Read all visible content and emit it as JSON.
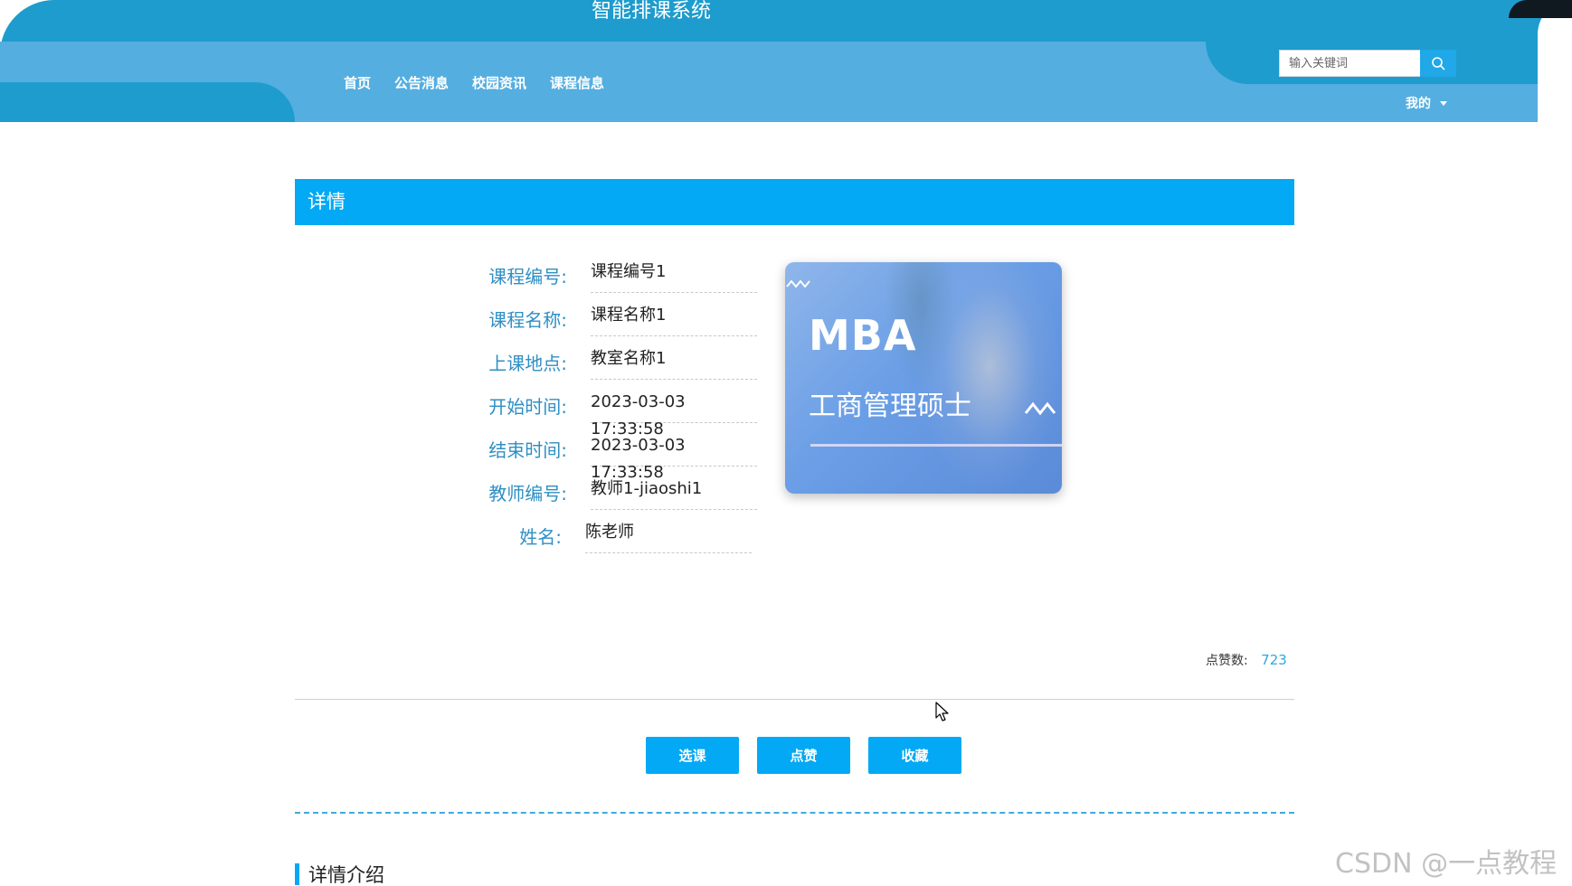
{
  "header": {
    "site_title": "智能排课系统",
    "nav": [
      "首页",
      "公告消息",
      "校园资讯",
      "课程信息"
    ],
    "search_placeholder": "输入关键词",
    "search_icon": "search-icon",
    "user_menu_label": "我的"
  },
  "detail": {
    "section_title": "详情",
    "fields": [
      {
        "label": "课程编号:",
        "value": "课程编号1"
      },
      {
        "label": "课程名称:",
        "value": "课程名称1"
      },
      {
        "label": "上课地点:",
        "value": "教室名称1"
      },
      {
        "label": "开始时间:",
        "value": "2023-03-03 17:33:58"
      },
      {
        "label": "结束时间:",
        "value": "2023-03-03 17:33:58"
      },
      {
        "label": "教师编号:",
        "value": "教师1-jiaoshi1"
      },
      {
        "label": "姓名:",
        "value": "陈老师"
      }
    ],
    "image": {
      "title": "MBA",
      "subtitle": "工商管理硕士"
    },
    "likes_label": "点赞数:",
    "likes_count": "723",
    "buttons": {
      "select": "选课",
      "like": "点赞",
      "favorite": "收藏"
    },
    "intro_title": "详情介绍"
  },
  "watermark": "CSDN @一点教程",
  "colors": {
    "header_dark": "#1e9ccd",
    "header_light": "#55aee0",
    "accent": "#03a9f4",
    "label": "#2f8fc4"
  }
}
